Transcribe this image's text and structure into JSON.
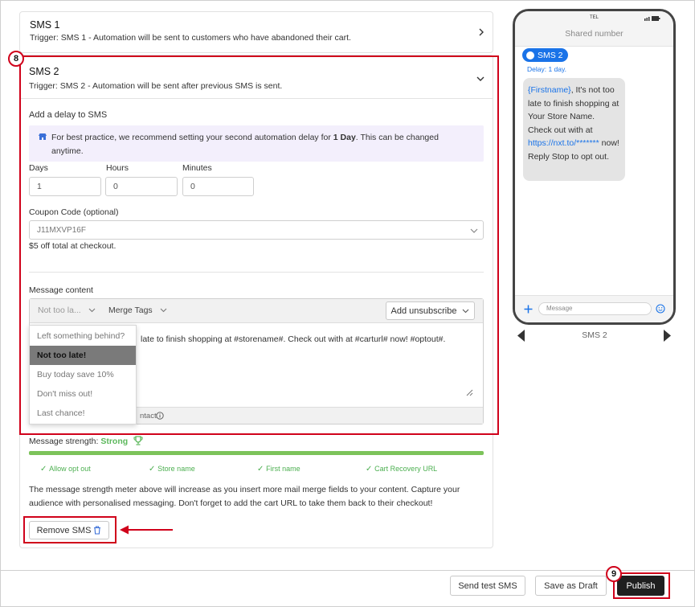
{
  "sms1": {
    "title": "SMS 1",
    "trigger": "Trigger: SMS 1 - Automation will be sent to customers who have abandoned their cart."
  },
  "callouts": {
    "section": "8",
    "publish": "9"
  },
  "sms2": {
    "title": "SMS 2",
    "trigger": "Trigger: SMS 2 - Automation will be sent after previous SMS is sent.",
    "delay_heading": "Add a delay to SMS",
    "tip": {
      "before": "For best practice, we recommend setting your second automation delay for ",
      "bold": "1 Day",
      "after": ". This can be changed anytime."
    },
    "days": {
      "label": "Days",
      "value": "1"
    },
    "hours": {
      "label": "Hours",
      "value": "0"
    },
    "minutes": {
      "label": "Minutes",
      "value": "0"
    },
    "coupon": {
      "label": "Coupon Code (optional)",
      "value": "J11MXVP16F",
      "note": "$5 off total at checkout."
    },
    "message": {
      "label": "Message content",
      "template_select": "Not too la...",
      "merge_tags": "Merge Tags",
      "add_unsubscribe": "Add unsubscribe",
      "body_visible": "late to finish shopping at #storename#. Check out with at #carturl# now! #optout#.",
      "footer_fragment": "ntact",
      "templates": [
        "Left something behind?",
        "Not too late!",
        "Buy today save 10%",
        "Don't miss out!",
        "Last chance!"
      ],
      "selected_index": 1
    },
    "strength": {
      "label": "Message strength:",
      "value": "Strong",
      "checks": [
        "Allow opt out",
        "Store name",
        "First name",
        "Cart Recovery URL"
      ],
      "level_pct": 100
    },
    "description": "The message strength meter above will increase as you insert more mail merge fields to your content. Capture your audience with personalised messaging. Don't forget to add the cart URL to take them back to their checkout!",
    "remove_button": "Remove SMS"
  },
  "phone": {
    "carrier": "TEL",
    "header": "Shared number",
    "sms_badge": "SMS 2",
    "delay": "Delay: 1 day.",
    "msg_firstname": "{Firstname}",
    "msg_part1": ", It's not too late to finish shopping at Your Store Name. Check out with at ",
    "msg_link": "https://nxt.to/*******",
    "msg_part2": " now! Reply Stop to opt out.",
    "input_placeholder": "Message",
    "pager_label": "SMS 2"
  },
  "footer": {
    "send_test": "Send test SMS",
    "save_draft": "Save as Draft",
    "publish": "Publish"
  },
  "colors": {
    "accent_red": "#d0021b",
    "strength_green": "#7cc35a",
    "link_blue": "#1a73e8",
    "tip_bg": "#f3effc"
  },
  "icons": [
    "chevron-right-icon",
    "chevron-down-icon",
    "store-icon",
    "info-icon",
    "trophy-icon",
    "check-icon",
    "trash-icon",
    "arrow-left-icon",
    "plus-icon",
    "emoji-icon",
    "prev-icon",
    "next-icon",
    "battery-icon"
  ]
}
